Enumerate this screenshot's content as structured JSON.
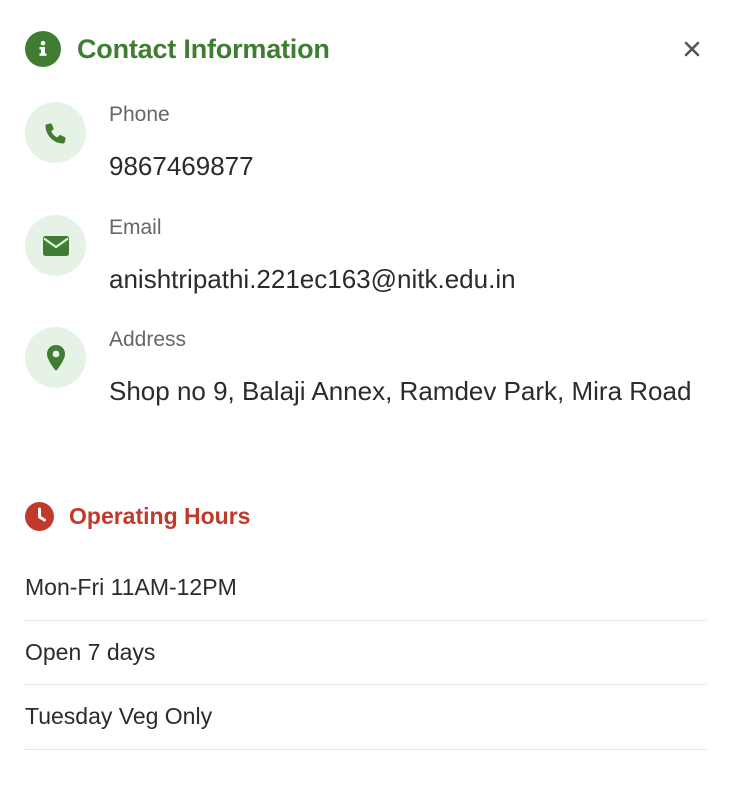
{
  "header": {
    "title": "Contact Information",
    "icon": "info-icon",
    "close_icon": "close-icon",
    "accent": "#3e7d32"
  },
  "contacts": [
    {
      "label": "Phone",
      "value": "9867469877",
      "icon": "phone-icon"
    },
    {
      "label": "Email",
      "value": "anishtripathi.221ec163@nitk.edu.in",
      "icon": "envelope-icon"
    },
    {
      "label": "Address",
      "value": "Shop no 9, Balaji Annex, Ramdev Park, Mira Road",
      "icon": "map-pin-icon"
    }
  ],
  "hours": {
    "title": "Operating Hours",
    "icon": "clock-icon",
    "accent": "#c0392b",
    "items": [
      "Mon-Fri 11AM-12PM",
      "Open 7 days",
      "Tuesday Veg Only"
    ]
  }
}
